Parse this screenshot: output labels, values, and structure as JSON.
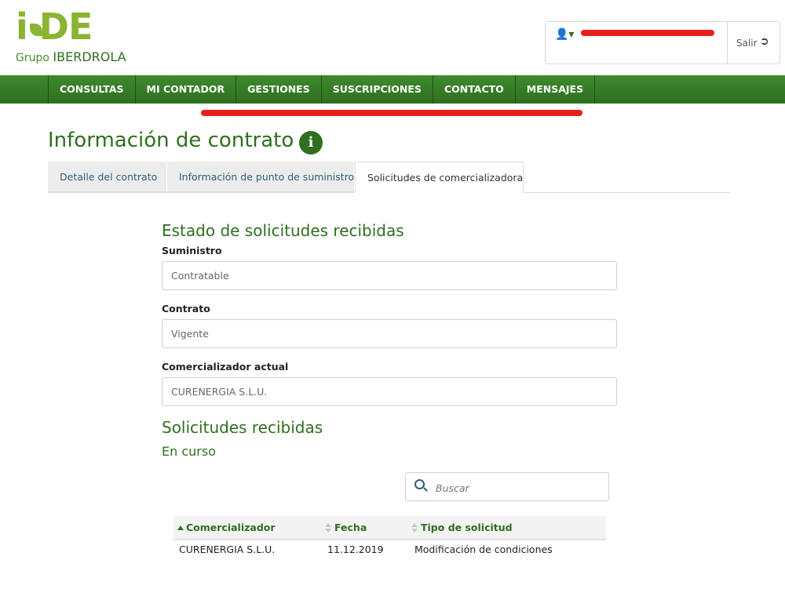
{
  "brand": {
    "mark": "i DE",
    "group_prefix": "Grupo",
    "group_name": "IBERDROLA"
  },
  "header": {
    "logout_label": "Salir"
  },
  "nav": {
    "items": [
      "CONSULTAS",
      "MI CONTADOR",
      "GESTIONES",
      "SUSCRIPCIONES",
      "CONTACTO",
      "MENSAJES"
    ]
  },
  "page": {
    "title": "Información de contrato"
  },
  "tabs": [
    {
      "label": "Detalle del contrato",
      "active": false
    },
    {
      "label": "Información de punto de suministro",
      "active": false
    },
    {
      "label": "Solicitudes de comercializadora",
      "active": true
    }
  ],
  "estado": {
    "heading": "Estado de solicitudes recibidas",
    "suministro_label": "Suministro",
    "suministro_value": "Contratable",
    "contrato_label": "Contrato",
    "contrato_value": "Vigente",
    "comercializador_label": "Comercializador actual",
    "comercializador_value": "CURENERGIA S.L.U."
  },
  "solicitudes": {
    "heading": "Solicitudes recibidas",
    "subheading": "En curso",
    "search_placeholder": "Buscar",
    "columns": [
      "Comercializador",
      "Fecha",
      "Tipo de solicitud"
    ],
    "rows": [
      [
        "CURENERGIA S.L.U.",
        "11.12.2019",
        "Modificación de condiciones"
      ]
    ]
  },
  "colors": {
    "brand_green": "#2f6f1f",
    "logo_green": "#8ab432",
    "redaction": "#e8201c"
  }
}
